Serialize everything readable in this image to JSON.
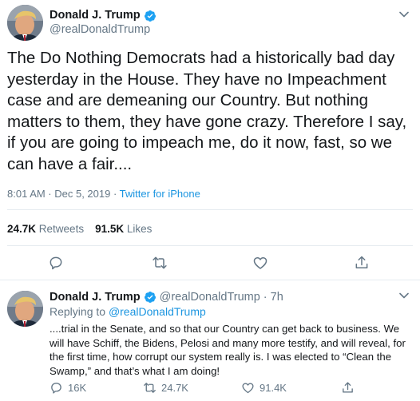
{
  "main_tweet": {
    "author_name": "Donald J. Trump",
    "author_handle": "@realDonaldTrump",
    "text": "The Do Nothing Democrats had a historically bad day yesterday in the House. They have no Impeachment case and are demeaning our Country. But nothing matters to them, they have gone crazy. Therefore I say, if you are going to impeach me, do it now, fast, so we can have a fair....",
    "timestamp": "8:01 AM · Dec 5, 2019 · ",
    "source": "Twitter for iPhone",
    "retweets_count": "24.7K",
    "retweets_label": "Retweets",
    "likes_count": "91.5K",
    "likes_label": "Likes"
  },
  "reply_tweet": {
    "author_name": "Donald J. Trump",
    "author_handle": "@realDonaldTrump",
    "time": "· 7h",
    "replying_prefix": "Replying to ",
    "replying_to": "@realDonaldTrump",
    "text": "....trial in the Senate, and so that our Country can get back to business. We will have Schiff, the Bidens, Pelosi and many more testify, and will reveal, for the first time, how corrupt our system really is. I was elected to “Clean the Swamp,” and that’s what I am doing!",
    "reply_count": "16K",
    "retweet_count": "24.7K",
    "like_count": "91.4K"
  },
  "colors": {
    "text": "#14171a",
    "secondary": "#657786",
    "link": "#1b95e0",
    "verified": "#1da1f2",
    "divider": "#e6ecf0"
  },
  "icons": [
    "verified-badge-icon",
    "chevron-down-icon",
    "reply-icon",
    "retweet-icon",
    "like-icon",
    "share-icon"
  ]
}
